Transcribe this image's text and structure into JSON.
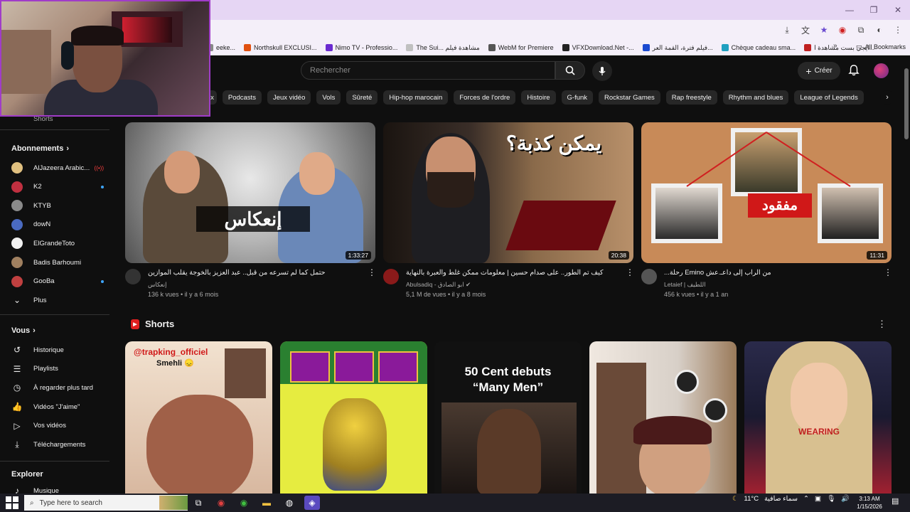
{
  "browser": {
    "bookmarks": [
      {
        "label": "eeke...",
        "color": "#888888"
      },
      {
        "label": "Northskull EXCLUSI...",
        "color": "#e05010"
      },
      {
        "label": "Nimo TV - Professio...",
        "color": "#6a2ad0"
      },
      {
        "label": "The Sui... مشاهدة فيلم",
        "color": "#c0c0c0"
      },
      {
        "label": "WebM for Premiere",
        "color": "#555555"
      },
      {
        "label": "VFXDownload.Net -...",
        "color": "#222222"
      },
      {
        "label": "فيلم فترة، القمة العر...",
        "color": "#1a4ad0"
      },
      {
        "label": "Chèque cadeau sma...",
        "color": "#20a0c0"
      },
      {
        "label": "ايجي بست مشاهدة ا...",
        "color": "#c02020"
      }
    ],
    "all_bookmarks": "All Bookmarks",
    "more": "»"
  },
  "header": {
    "search_placeholder": "Rechercher",
    "create_label": "Créer"
  },
  "chips": [
    "ix",
    "Podcasts",
    "Jeux vidéo",
    "Vols",
    "Sûreté",
    "Hip-hop marocain",
    "Forces de l'ordre",
    "Histoire",
    "G-funk",
    "Rockstar Games",
    "Rap freestyle",
    "Rhythm and blues",
    "League of Legends"
  ],
  "sidebar": {
    "shorts_partial": "Shorts",
    "subscriptions_title": "Abonnements",
    "subscriptions": [
      {
        "label": "AlJazeera Arabic...",
        "color": "#e0c080",
        "badge": "live"
      },
      {
        "label": "K2",
        "color": "#c03040",
        "badge": "dot"
      },
      {
        "label": "KTYB",
        "color": "#8a8a8a",
        "badge": ""
      },
      {
        "label": "dowN",
        "color": "#4a6ac0",
        "badge": ""
      },
      {
        "label": "ElGrandeToto",
        "color": "#f0f0f0",
        "badge": ""
      },
      {
        "label": "Badis Barhoumi",
        "color": "#a08060",
        "badge": ""
      },
      {
        "label": "GooBa",
        "color": "#c04040",
        "badge": "dot"
      }
    ],
    "more_label": "Plus",
    "you_title": "Vous",
    "you_items": [
      {
        "label": "Historique",
        "icon": "history-icon"
      },
      {
        "label": "Playlists",
        "icon": "playlists-icon"
      },
      {
        "label": "À regarder plus tard",
        "icon": "watch-later-icon"
      },
      {
        "label": "Vidéos \"J'aime\"",
        "icon": "like-icon"
      },
      {
        "label": "Vos vidéos",
        "icon": "your-videos-icon"
      },
      {
        "label": "Téléchargements",
        "icon": "downloads-icon"
      }
    ],
    "explore_title": "Explorer",
    "explore_items": [
      {
        "label": "Musique",
        "icon": "music-icon"
      }
    ]
  },
  "videos": [
    {
      "title": "حتمل كما لم تسرعه من قبل.. عبد العزيز بالخوجة يقلب الموازين",
      "channel": "إنعكاس",
      "meta": "136 k vues • il y a 6 mois",
      "duration": "1:33:27",
      "thumb_text": "إنعكاس",
      "avatar_color": "#333333",
      "verified": false
    },
    {
      "title": "كيف تم الطور.. على صدام حسين | معلومات ممكن غلط والعبرة بالنهاية",
      "channel": "Abulsadiq - ابو الصادق",
      "meta": "5,1 M de vues • il y a 8 mois",
      "duration": "20:38",
      "thumb_text": "يمكن كذبة؟",
      "avatar_color": "#8a1a1a",
      "verified": true
    },
    {
      "title": "...رحلة Emino من الراب إلى داعـ.عش",
      "channel": "Letaief | اللطيف",
      "meta": "456 k vues • il y a 1 an",
      "duration": "11:31",
      "thumb_text": "مفقود",
      "avatar_color": "#555555",
      "verified": false
    }
  ],
  "shorts": {
    "title": "Shorts",
    "items": [
      {
        "top_text": "@trapking_officiel",
        "sub_text": "Smehli 😞"
      },
      {
        "top_text": "",
        "sub_text": ""
      },
      {
        "top_text": "50 Cent debuts",
        "sub_text": "“Many Men”"
      },
      {
        "top_text": "",
        "sub_text": ""
      },
      {
        "top_text": "WEARING",
        "sub_text": ""
      }
    ]
  },
  "taskbar": {
    "search_placeholder": "Type here to search",
    "weather_temp": "11°C",
    "weather_text": "سماء صافية",
    "time": "3:13 AM",
    "date": "1/15/2026"
  }
}
